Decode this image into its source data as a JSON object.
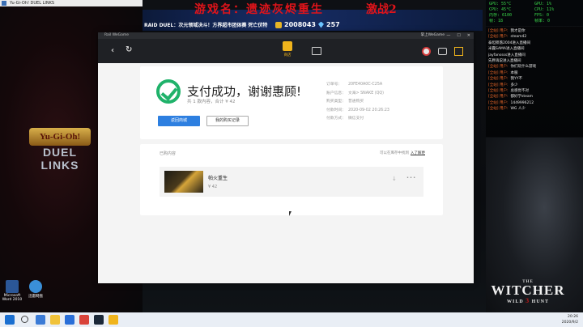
{
  "game_window": {
    "title": "Yu-Gi-Oh! DUEL LINKS",
    "logo_line1": "Yu-Gi-Oh!",
    "logo_line2": "DUEL LINKS"
  },
  "stream_overlay": {
    "title_text": "游戏名：遗迹灰烬重生",
    "title_suffix": "激战2",
    "banner_text": "RAID DUEL：次元领域决斗！方界超市团体赛 死亡伏特",
    "coins": "2008043",
    "gems": "257"
  },
  "perf": [
    [
      "GPU: 55°C",
      "GPU: 1%"
    ],
    [
      "CPU: 45°C",
      "CPU: 11%"
    ],
    [
      "内存: 6100",
      "FPS: 0"
    ],
    [
      "帧: 18",
      "帧率: 0"
    ]
  ],
  "chat": [
    {
      "nick": "[全站] 用户:",
      "name": "",
      "msg": "我才是你"
    },
    {
      "nick": "[全站] 用户:",
      "name": "",
      "msg": "steam42"
    },
    {
      "nick": "",
      "name": "",
      "msg": "泰坦陨落2004进入直播间"
    },
    {
      "nick": "",
      "name": "",
      "msg": "米露SAMA进入直播间"
    },
    {
      "nick": "",
      "name": "",
      "msg": "jayfanssss进入直播间"
    },
    {
      "nick": "",
      "name": "",
      "msg": "先胖再说进入直播间"
    },
    {
      "nick": "[全站] 用户:",
      "name": "",
      "msg": "你们玩什么游戏"
    },
    {
      "nick": "[全站] 用户:",
      "name": "",
      "msg": "本服"
    },
    {
      "nick": "[全站] 用户:",
      "name": "",
      "msg": "我YY不"
    },
    {
      "nick": "[全站] 用户:",
      "name": "",
      "msg": "多少"
    },
    {
      "nick": "[全站] 用户:",
      "name": "",
      "msg": "总感觉不对"
    },
    {
      "nick": "[全站] 用户:",
      "name": "",
      "msg": "都好学steam"
    },
    {
      "nick": "[全站] 用户:",
      "name": "",
      "msg": "1449996212"
    },
    {
      "nick": "[全站] 用户:",
      "name": "",
      "msg": "WG 人少"
    }
  ],
  "witcher": {
    "the": "THE",
    "name": "WITCHER",
    "left": "WILD",
    "num": "3",
    "right": "HUNT"
  },
  "desktop_icons": [
    {
      "label": "Microsoft Word 2010"
    },
    {
      "label": "迅雷网盘"
    }
  ],
  "store_window": {
    "app_name": "Rail WeGame",
    "user_label": "掌上WeGame",
    "toolbar": {
      "store_label": "商店"
    },
    "payment": {
      "title": "支付成功，谢谢惠顾!",
      "subtitle": "共 1 款内容，合计 ¥ 42",
      "return_button": "返回商城",
      "records_button": "我的购买记录",
      "order_rows": [
        {
          "key": "订单号：",
          "value": "20FE40A0C-C25A"
        },
        {
          "key": "账户信息：",
          "value": "文海> SNAKE (QQ)"
        },
        {
          "key": "购买类型：",
          "value": "普通购买"
        },
        {
          "key": "付款时间：",
          "value": "2020-09-02 20:26:23"
        },
        {
          "key": "付款方式：",
          "value": "微信支付"
        }
      ]
    },
    "purchased": {
      "title": "已购内容",
      "tip": "可以在库存中找到",
      "tip_link": "入了解更",
      "items": [
        {
          "name": "帕火重生",
          "price": "¥ 42"
        }
      ]
    }
  },
  "taskbar": {
    "time": "20:26",
    "date": "2020/9/2"
  }
}
